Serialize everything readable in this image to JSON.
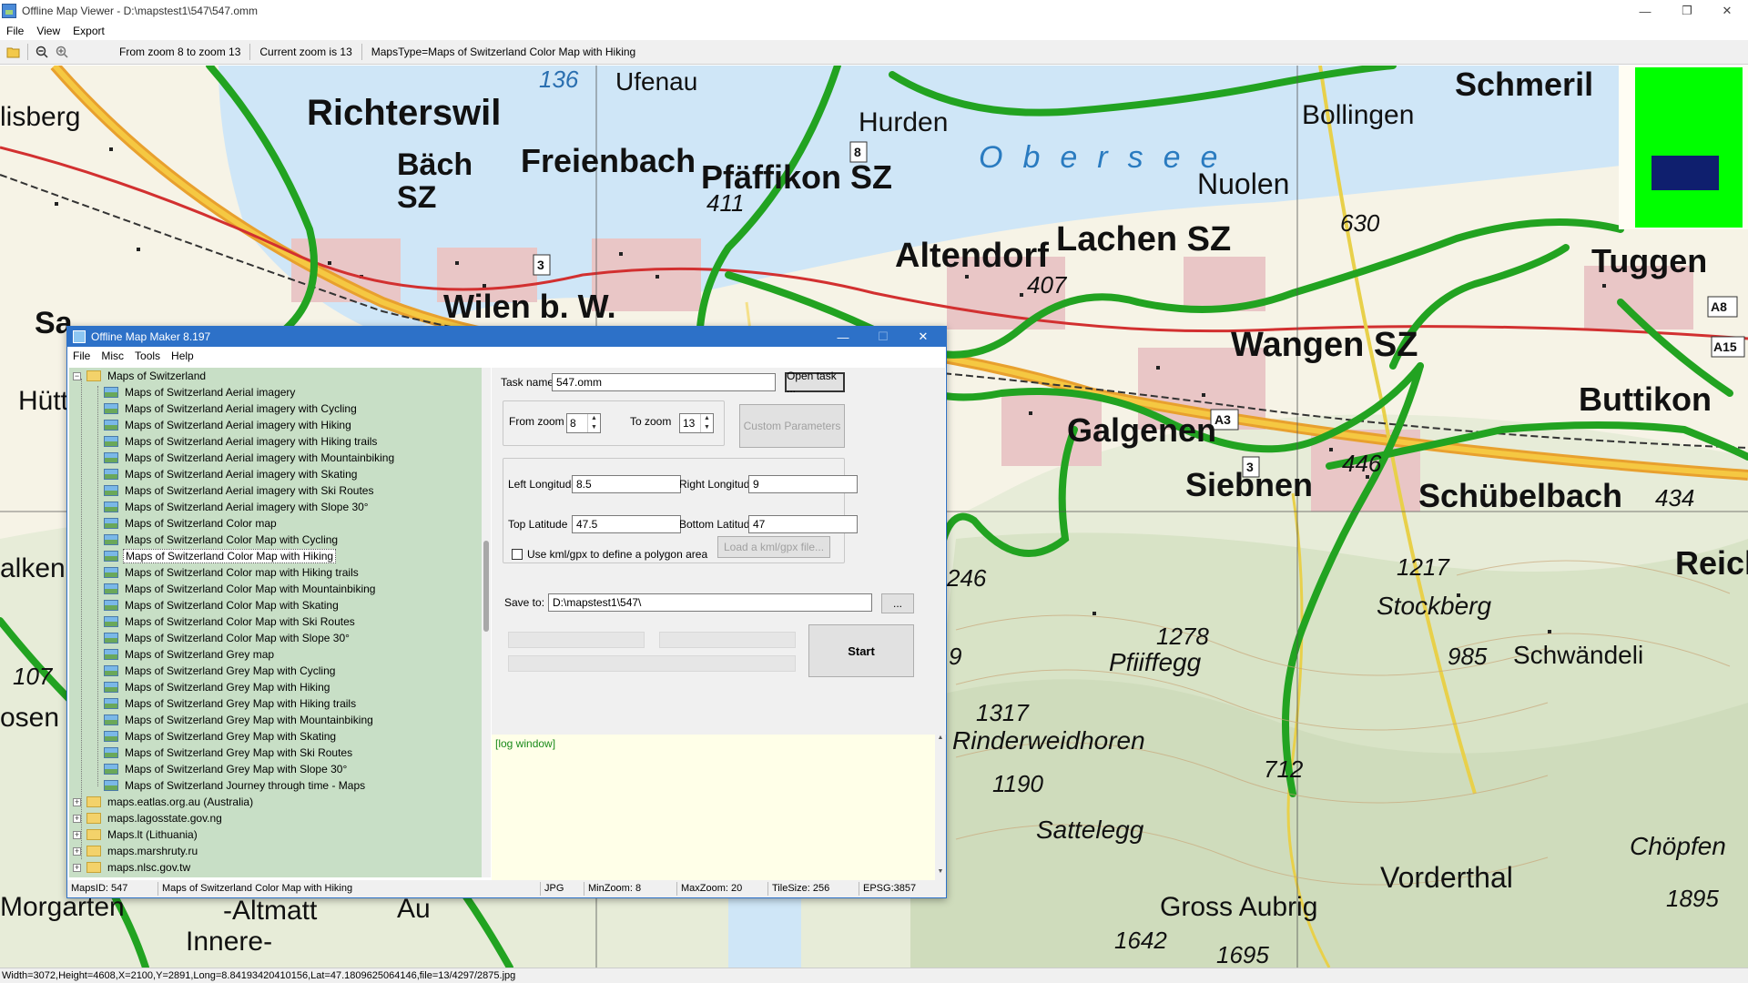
{
  "main_window": {
    "title": "Offline Map Viewer - D:\\mapstest1\\547\\547.omm",
    "menu": [
      "File",
      "View",
      "Export"
    ],
    "toolbar": {
      "open_icon": "folder-open-icon",
      "zoom_out_icon": "zoom-out-icon",
      "zoom_in_icon": "zoom-in-icon",
      "zoom_range": "From zoom 8 to zoom 13",
      "current_zoom": "Current zoom is 13",
      "maps_type": "MapsType=Maps of Switzerland Color Map with Hiking"
    },
    "status": "Width=3072,Height=4608,X=2100,Y=2891,Long=8.84193420410156,Lat=47.1809625064146,file=13/4297/2875.jpg"
  },
  "map": {
    "labels": [
      "Richterswil",
      "Bäch",
      "SZ",
      "Freienbach",
      "Pfäffikon SZ",
      "Hurden",
      "Ufenau",
      "Bollingen",
      "Schmeril",
      "Nuolen",
      "Obersee",
      "Altendorf",
      "Lachen SZ",
      "Tuggen",
      "Wilen b. W.",
      "Wangen SZ",
      "Buttikon",
      "Galgenen",
      "Siebnen",
      "Schübelbach",
      "Stockberg",
      "Schwändeli",
      "Pfiiffegg",
      "Rinderweidhoren",
      "Sattelegg",
      "Vorderthal",
      "Gross Aubrig",
      "Chöpfen",
      "Reich",
      "-Altmatt",
      "Innere-",
      "Morgarten",
      "Hütt",
      "alkenb",
      "osen",
      "lisberg",
      "Sa",
      "Au"
    ],
    "numbers": [
      "136",
      "411",
      "407",
      "446",
      "434",
      "630",
      "1217",
      "985",
      "1278",
      "1317",
      "1190",
      "712",
      "1642",
      "1695",
      "1895",
      "246",
      "107",
      "9"
    ],
    "road_markers": [
      "3",
      "8",
      "A8",
      "A15",
      "A3",
      "3",
      "3"
    ]
  },
  "dialog": {
    "title": "Offline Map Maker 8.197",
    "menu": [
      "File",
      "Misc",
      "Tools",
      "Help"
    ],
    "tree": {
      "root": "Maps of Switzerland",
      "children": [
        "Maps of Switzerland Aerial imagery",
        "Maps of Switzerland Aerial imagery with Cycling",
        "Maps of Switzerland Aerial imagery with Hiking",
        "Maps of Switzerland Aerial imagery with Hiking trails",
        "Maps of Switzerland Aerial imagery with Mountainbiking",
        "Maps of Switzerland Aerial imagery with Skating",
        "Maps of Switzerland Aerial imagery with Ski Routes",
        "Maps of Switzerland Aerial imagery with Slope 30°",
        "Maps of Switzerland Color map",
        "Maps of Switzerland Color Map with Cycling",
        "Maps of Switzerland Color Map with Hiking",
        "Maps of Switzerland Color map with Hiking trails",
        "Maps of Switzerland Color Map with Mountainbiking",
        "Maps of Switzerland Color Map with Skating",
        "Maps of Switzerland Color Map with Ski Routes",
        "Maps of Switzerland Color Map with Slope 30°",
        "Maps of Switzerland Grey map",
        "Maps of Switzerland Grey Map with Cycling",
        "Maps of Switzerland Grey Map with Hiking",
        "Maps of Switzerland Grey Map with Hiking trails",
        "Maps of Switzerland Grey Map with Mountainbiking",
        "Maps of Switzerland Grey Map with Skating",
        "Maps of Switzerland Grey Map with Ski Routes",
        "Maps of Switzerland Grey Map with Slope 30°",
        "Maps of Switzerland Journey through time - Maps"
      ],
      "selected_index": 10,
      "other_roots": [
        "maps.eatlas.org.au (Australia)",
        "maps.lagosstate.gov.ng",
        "Maps.lt (Lithuania)",
        "maps.marshruty.ru",
        "maps.nlsc.gov.tw"
      ]
    },
    "form": {
      "task_name_label": "Task name",
      "task_name_value": "547.omm",
      "open_task": "Open task ...",
      "from_zoom_label": "From zoom",
      "from_zoom_value": "8",
      "to_zoom_label": "To zoom",
      "to_zoom_value": "13",
      "custom_params": "Custom Parameters",
      "left_lon_label": "Left Longitude",
      "left_lon_value": "8.5",
      "right_lon_label": "Right Longitude",
      "right_lon_value": "9",
      "top_lat_label": "Top Latitude",
      "top_lat_value": "47.5",
      "bottom_lat_label": "Bottom Latitude",
      "bottom_lat_value": "47",
      "kml_check_label": "Use kml/gpx to define a polygon area",
      "kml_button": "Load a kml/gpx file...",
      "save_to_label": "Save to:",
      "save_to_value": "D:\\mapstest1\\547\\",
      "browse": "...",
      "start": "Start"
    },
    "log": "[log window]",
    "status": {
      "maps_id": "MapsID: 547",
      "maps_name": "Maps of Switzerland Color Map with Hiking",
      "format": "JPG",
      "min_zoom": "MinZoom: 8",
      "max_zoom": "MaxZoom: 20",
      "tile_size": "TileSize: 256",
      "epsg": "EPSG:3857"
    }
  },
  "colors": {
    "dialog_title_bg": "#2d71c8",
    "tree_bg": "#c8dfc6",
    "log_bg": "#ffffe8",
    "hiking_trail": "#22a321",
    "lake": "#cfe6f7",
    "minimap_green": "#00ff00",
    "minimap_blue": "#0f1f6e"
  }
}
